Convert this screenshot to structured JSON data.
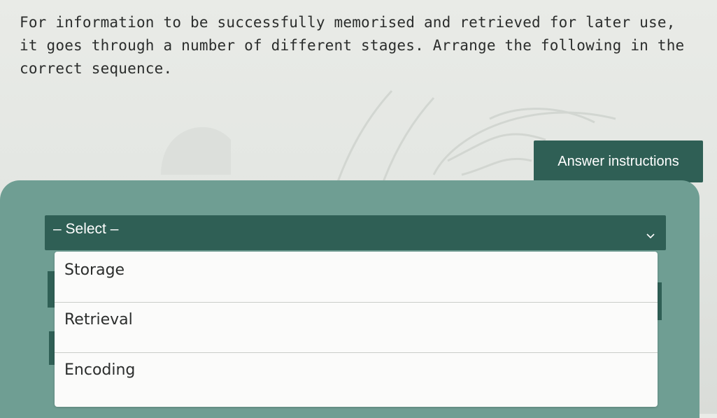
{
  "question": {
    "text": "For information to be successfully memorised and retrieved for later use, it goes through a number of different stages. Arrange the following in the correct sequence."
  },
  "instructions_button": {
    "label": "Answer instructions"
  },
  "select": {
    "placeholder": "– Select –",
    "icon": "chevron-down-icon",
    "options": [
      "Storage",
      "Retrieval",
      "Encoding"
    ]
  },
  "colors": {
    "accent_dark": "#2f5f55",
    "panel": "#6f9e93",
    "background": "#e3e6e2"
  }
}
